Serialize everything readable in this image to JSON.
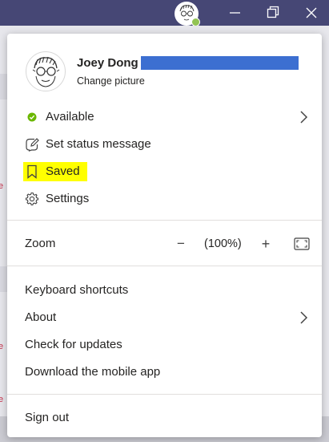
{
  "titlebar": {
    "presence_color": "#92c353",
    "window_controls": [
      "minimize-icon",
      "maximize-icon",
      "close-icon"
    ]
  },
  "profile": {
    "name": "Joey Dong",
    "change_picture": "Change picture"
  },
  "status": {
    "available": "Available",
    "available_color": "#6bb700",
    "set_status_message": "Set status message"
  },
  "menu": {
    "saved": "Saved",
    "saved_highlight_color": "#ffff00",
    "settings": "Settings",
    "zoom": {
      "label": "Zoom",
      "level": "(100%)",
      "minus": "−",
      "plus": "+"
    },
    "keyboard_shortcuts": "Keyboard shortcuts",
    "about": "About",
    "check_for_updates": "Check for updates",
    "download_mobile_app": "Download the mobile app",
    "sign_out": "Sign out"
  },
  "background": {
    "accent_mark": "e",
    "accent_color": "#c4314b"
  }
}
